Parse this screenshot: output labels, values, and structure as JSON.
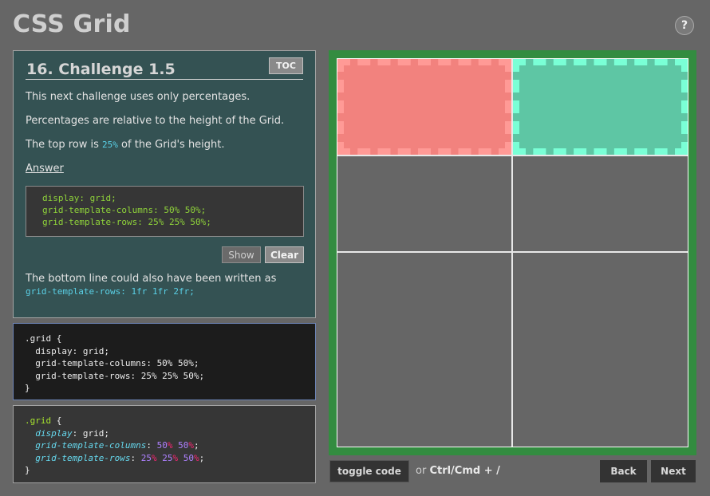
{
  "app": {
    "title": "CSS Grid",
    "help_label": "?"
  },
  "lesson": {
    "title": "16. Challenge 1.5",
    "toc_label": "TOC",
    "paragraphs": [
      "This next challenge uses only percentages.",
      "Percentages are relative to the height of the Grid."
    ],
    "p3_before": "The top row is ",
    "p3_highlight": "25%",
    "p3_after": " of the Grid's height.",
    "answer_link": "Answer",
    "answer_code": [
      "display: grid;",
      "grid-template-columns: 50% 50%;",
      "grid-template-rows: 25% 25% 50%;"
    ],
    "show_label": "Show",
    "clear_label": "Clear",
    "note_text": "The bottom line could also have been written as",
    "note_code": "grid-template-rows: 1fr 1fr 2fr;"
  },
  "editor": {
    "lines": [
      ".grid {",
      "  display: grid;",
      "  grid-template-columns: 50% 50%;",
      "  grid-template-rows: 25% 25% 50%;",
      "}"
    ]
  },
  "preview_code": {
    "selector": ".grid",
    "open_brace": " {",
    "close_brace": "}",
    "display_prop": "display",
    "display_val": "grid",
    "columns_prop": "grid-template-columns",
    "columns_vals": [
      [
        "50",
        "%"
      ],
      [
        "50",
        "%"
      ]
    ],
    "rows_prop": "grid-template-rows",
    "rows_vals": [
      [
        "25",
        "%"
      ],
      [
        "25",
        "%"
      ],
      [
        "50",
        "%"
      ]
    ]
  },
  "grid_preview": {
    "columns_percent": [
      50,
      50
    ],
    "rows_percent": [
      25,
      25,
      50
    ],
    "cells": 6,
    "items": [
      {
        "name": "grid-item-red",
        "color": "#f2827e",
        "border_color": "#ff9a96"
      },
      {
        "name": "grid-item-green",
        "color": "#5ec6a4",
        "border_color": "#7affd6"
      }
    ],
    "frame_color": "#338c40"
  },
  "toolbar": {
    "toggle_label": "toggle code",
    "shortcut_or": "or ",
    "shortcut_keys": "Ctrl/Cmd + /",
    "back_label": "Back",
    "next_label": "Next"
  }
}
